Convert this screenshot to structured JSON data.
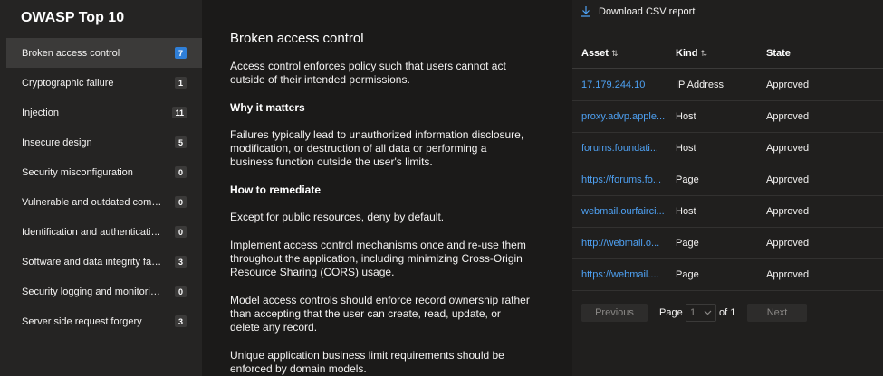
{
  "sidebar": {
    "title": "OWASP Top 10",
    "items": [
      {
        "label": "Broken access control",
        "count": "7",
        "active": true
      },
      {
        "label": "Cryptographic failure",
        "count": "1"
      },
      {
        "label": "Injection",
        "count": "11"
      },
      {
        "label": "Insecure design",
        "count": "5"
      },
      {
        "label": "Security misconfiguration",
        "count": "0"
      },
      {
        "label": "Vulnerable and outdated compon...",
        "count": "0"
      },
      {
        "label": "Identification and authentication ...",
        "count": "0"
      },
      {
        "label": "Software and data integrity failures",
        "count": "3"
      },
      {
        "label": "Security logging and monitoring ...",
        "count": "0"
      },
      {
        "label": "Server side request forgery",
        "count": "3"
      }
    ]
  },
  "detail": {
    "title": "Broken access control",
    "intro": "Access control enforces policy such that users cannot act outside of their intended permissions.",
    "why_heading": "Why it matters",
    "why_text": "Failures typically lead to unauthorized information disclosure, modification, or destruction of all data or performing a business function outside the user's limits.",
    "remediate_heading": "How to remediate",
    "remediate_items": [
      "Except for public resources, deny by default.",
      "Implement access control mechanisms once and re-use them throughout the application, including minimizing Cross-Origin Resource Sharing (CORS) usage.",
      "Model access controls should enforce record ownership rather than accepting that the user can create, read, update, or delete any record.",
      "Unique application business limit requirements should be enforced by domain models."
    ]
  },
  "report": {
    "download_label": "Download CSV report",
    "columns": {
      "asset": "Asset",
      "kind": "Kind",
      "state": "State"
    },
    "rows": [
      {
        "asset": "17.179.244.10",
        "kind": "IP Address",
        "state": "Approved"
      },
      {
        "asset": "proxy.advp.apple...",
        "kind": "Host",
        "state": "Approved"
      },
      {
        "asset": "forums.foundati...",
        "kind": "Host",
        "state": "Approved"
      },
      {
        "asset": "https://forums.fo...",
        "kind": "Page",
        "state": "Approved"
      },
      {
        "asset": "webmail.ourfairci...",
        "kind": "Host",
        "state": "Approved"
      },
      {
        "asset": "http://webmail.o...",
        "kind": "Page",
        "state": "Approved"
      },
      {
        "asset": "https://webmail....",
        "kind": "Page",
        "state": "Approved"
      }
    ],
    "pager": {
      "previous_label": "Previous",
      "page_label": "Page",
      "current_page": "1",
      "of_label": "of 1",
      "next_label": "Next"
    }
  },
  "colors": {
    "accent": "#2f7fd8",
    "link": "#4ea1f3",
    "background": "#1b1a19",
    "sidebar": "#252423"
  }
}
